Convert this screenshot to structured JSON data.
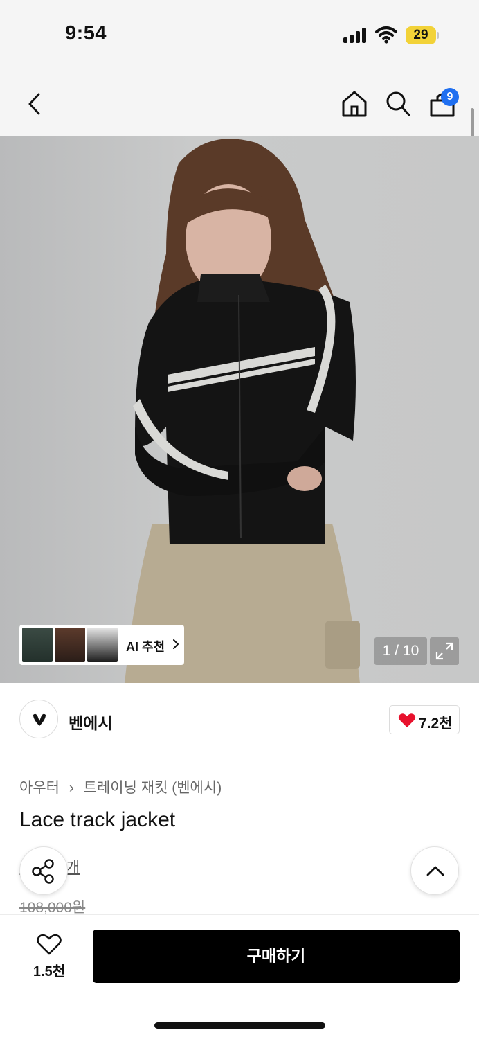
{
  "status_bar": {
    "time": "9:54",
    "battery": "29"
  },
  "header": {
    "icons": [
      "back-arrow-icon",
      "home-icon",
      "search-icon",
      "shopping-bag-icon"
    ],
    "cart_count": "9"
  },
  "gallery": {
    "counter": "1 / 10",
    "ai_recommend_label": "AI 추천",
    "icons": [
      "chevron-right-icon",
      "expand-icon"
    ]
  },
  "brand": {
    "name": "벤에시",
    "like_count": "7.2천"
  },
  "product": {
    "breadcrumb": [
      "아우터",
      "트레이닝 재킷 (벤에시)"
    ],
    "title": "Lace track jacket",
    "review_link": "후기 27개",
    "original_price": "108,000원"
  },
  "floating": {
    "icons": [
      "share-icon",
      "chevron-up-icon"
    ]
  },
  "bottom_bar": {
    "wish_count": "1.5천",
    "buy_label": "구매하기"
  },
  "colors": {
    "accent_badge": "#1f6ff0",
    "like_heart": "#e8112d",
    "buy_button": "#000000",
    "battery": "#f2d238"
  }
}
